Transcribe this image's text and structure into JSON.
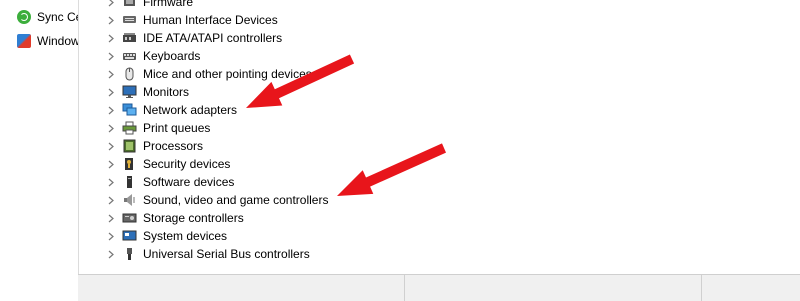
{
  "left_panel": {
    "items": [
      {
        "label": "Sync Ce",
        "icon": "sync-center-icon"
      },
      {
        "label": "Window",
        "icon": "windows-icon"
      }
    ]
  },
  "device_tree": {
    "categories": [
      {
        "label": "Firmware",
        "icon": "firmware-icon"
      },
      {
        "label": "Human Interface Devices",
        "icon": "hid-icon"
      },
      {
        "label": "IDE ATA/ATAPI controllers",
        "icon": "ide-controller-icon"
      },
      {
        "label": "Keyboards",
        "icon": "keyboard-icon"
      },
      {
        "label": "Mice and other pointing devices",
        "icon": "mouse-icon"
      },
      {
        "label": "Monitors",
        "icon": "monitor-icon"
      },
      {
        "label": "Network adapters",
        "icon": "network-adapter-icon"
      },
      {
        "label": "Print queues",
        "icon": "printer-icon"
      },
      {
        "label": "Processors",
        "icon": "processor-icon"
      },
      {
        "label": "Security devices",
        "icon": "security-device-icon"
      },
      {
        "label": "Software devices",
        "icon": "software-device-icon"
      },
      {
        "label": "Sound, video and game controllers",
        "icon": "speaker-icon"
      },
      {
        "label": "Storage controllers",
        "icon": "storage-controller-icon"
      },
      {
        "label": "System devices",
        "icon": "system-device-icon"
      },
      {
        "label": "Universal Serial Bus controllers",
        "icon": "usb-icon"
      }
    ]
  },
  "annotations": {
    "arrow_color": "#e8151b",
    "arrow_targets": [
      "Network adapters",
      "Sound, video and game controllers"
    ]
  }
}
